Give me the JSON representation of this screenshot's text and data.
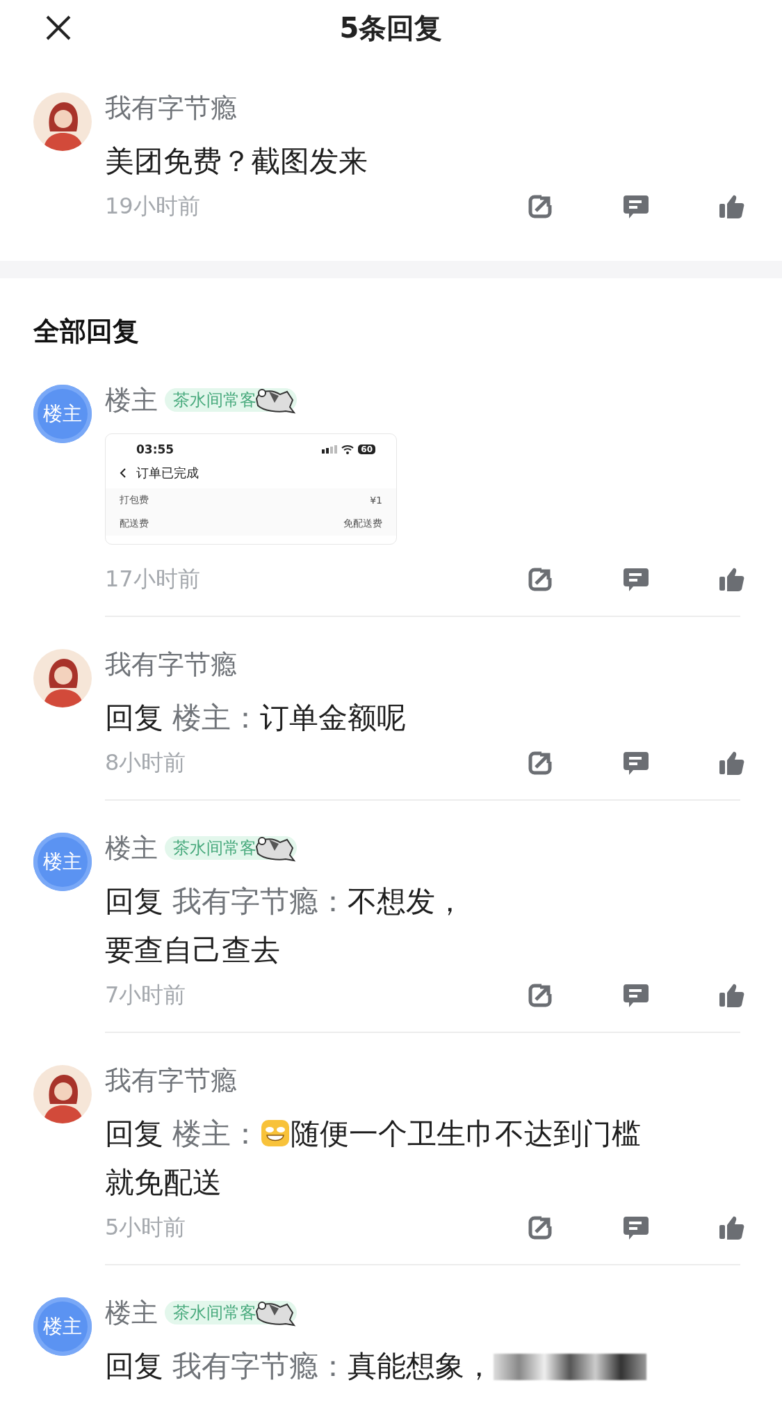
{
  "header": {
    "title": "5条回复"
  },
  "original_comment": {
    "author": "我有字节瘾",
    "avatar": {
      "kind": "illustration"
    },
    "content": [
      {
        "kind": "text",
        "text": "美团免费？截图发来"
      }
    ],
    "time": "19小时前"
  },
  "section_title": "全部回复",
  "replies": [
    {
      "author": "楼主",
      "avatar": {
        "kind": "text",
        "label": "楼主"
      },
      "badge": "茶水间常客",
      "content": [
        {
          "kind": "image",
          "status_time": "03:55",
          "battery": "60",
          "title": "订单已完成",
          "rows": [
            {
              "label": "打包费",
              "value": "¥1"
            },
            {
              "label": "配送费",
              "value": "免配送费"
            }
          ]
        }
      ],
      "time": "17小时前"
    },
    {
      "author": "我有字节瘾",
      "avatar": {
        "kind": "illustration"
      },
      "reply_label": "回复",
      "reply_to": "楼主：",
      "content": [
        {
          "kind": "text",
          "text": "订单金额呢"
        }
      ],
      "time": "8小时前"
    },
    {
      "author": "楼主",
      "avatar": {
        "kind": "text",
        "label": "楼主"
      },
      "badge": "茶水间常客",
      "reply_label": "回复",
      "reply_to": "我有字节瘾：",
      "content": [
        {
          "kind": "text",
          "text": "不想发，"
        },
        {
          "kind": "line",
          "text": "要查自己查去"
        }
      ],
      "time": "7小时前"
    },
    {
      "author": "我有字节瘾",
      "avatar": {
        "kind": "illustration"
      },
      "reply_label": "回复",
      "reply_to": "楼主：",
      "content": [
        {
          "kind": "emoji"
        },
        {
          "kind": "text",
          "text": "随便一个卫生巾不达到门槛就免配送"
        }
      ],
      "time": "5小时前"
    },
    {
      "author": "楼主",
      "avatar": {
        "kind": "text",
        "label": "楼主"
      },
      "badge": "茶水间常客",
      "reply_label": "回复",
      "reply_to": "我有字节瘾：",
      "content": [
        {
          "kind": "text",
          "text": "真能想象，"
        },
        {
          "kind": "redacted"
        }
      ]
    }
  ]
}
